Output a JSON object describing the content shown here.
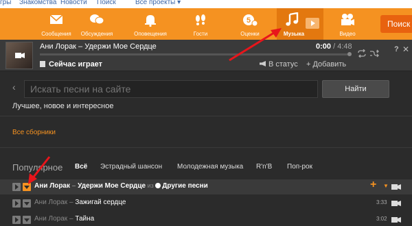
{
  "toplinks": {
    "games": "гры",
    "dating": "Знакомства",
    "news": "Новости",
    "search": "Поиск",
    "all_projects": "Все проекты"
  },
  "nav": {
    "items": [
      {
        "label": "Сообщения",
        "icon": "envelope-icon"
      },
      {
        "label": "Обсуждения",
        "icon": "chat-bubbles-icon"
      },
      {
        "label": "Оповещения",
        "icon": "bell-icon"
      },
      {
        "label": "Гости",
        "icon": "footprints-icon"
      },
      {
        "label": "Оценки",
        "icon": "rating-five-icon"
      },
      {
        "label": "Музыка",
        "icon": "music-note-icon"
      },
      {
        "label": "Видео",
        "icon": "video-camera-icon"
      }
    ],
    "search_label": "Поиск",
    "accent": "#f59221"
  },
  "player": {
    "track": "Ани Лорак – Удержи Мое Сердце",
    "time_current": "0:00",
    "time_total": " / 4:48",
    "progress": 0,
    "now_playing": "Сейчас играет",
    "to_status": "В статус",
    "add": "+ Добавить",
    "help": "?",
    "close": "✕"
  },
  "search": {
    "placeholder": "Искать песни на сайте",
    "button": "Найти"
  },
  "best_new": "Лучшее, новое и интересное",
  "all_collections": "Все сборники",
  "popular": {
    "title": "Популярное",
    "tabs": [
      "Всё",
      "Эстрадный шансон",
      "Молодежная музыка",
      "R'n'B",
      "Поп-рок"
    ]
  },
  "songs": [
    {
      "artist": "Ани Лорак",
      "sep": " – ",
      "title": "Удержи Мое Сердце",
      "from": " из ",
      "album": "Другие песни",
      "duration": ""
    },
    {
      "artist": "Ани Лорак",
      "sep": " – ",
      "title": "Зажигай сердце",
      "from": "",
      "album": "",
      "duration": "3:33"
    },
    {
      "artist": "Ани Лорак",
      "sep": " – ",
      "title": "Тайна",
      "from": "",
      "album": "",
      "duration": "3:02"
    }
  ]
}
